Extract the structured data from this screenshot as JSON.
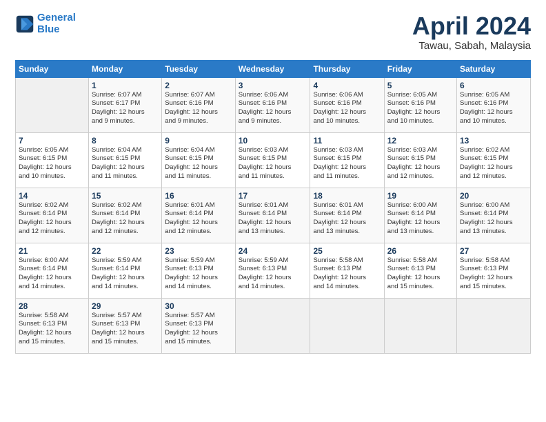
{
  "header": {
    "logo_line1": "General",
    "logo_line2": "Blue",
    "month": "April 2024",
    "location": "Tawau, Sabah, Malaysia"
  },
  "weekdays": [
    "Sunday",
    "Monday",
    "Tuesday",
    "Wednesday",
    "Thursday",
    "Friday",
    "Saturday"
  ],
  "weeks": [
    [
      {
        "day": "",
        "info": ""
      },
      {
        "day": "1",
        "info": "Sunrise: 6:07 AM\nSunset: 6:17 PM\nDaylight: 12 hours\nand 9 minutes."
      },
      {
        "day": "2",
        "info": "Sunrise: 6:07 AM\nSunset: 6:16 PM\nDaylight: 12 hours\nand 9 minutes."
      },
      {
        "day": "3",
        "info": "Sunrise: 6:06 AM\nSunset: 6:16 PM\nDaylight: 12 hours\nand 9 minutes."
      },
      {
        "day": "4",
        "info": "Sunrise: 6:06 AM\nSunset: 6:16 PM\nDaylight: 12 hours\nand 10 minutes."
      },
      {
        "day": "5",
        "info": "Sunrise: 6:05 AM\nSunset: 6:16 PM\nDaylight: 12 hours\nand 10 minutes."
      },
      {
        "day": "6",
        "info": "Sunrise: 6:05 AM\nSunset: 6:16 PM\nDaylight: 12 hours\nand 10 minutes."
      }
    ],
    [
      {
        "day": "7",
        "info": "Sunrise: 6:05 AM\nSunset: 6:15 PM\nDaylight: 12 hours\nand 10 minutes."
      },
      {
        "day": "8",
        "info": "Sunrise: 6:04 AM\nSunset: 6:15 PM\nDaylight: 12 hours\nand 11 minutes."
      },
      {
        "day": "9",
        "info": "Sunrise: 6:04 AM\nSunset: 6:15 PM\nDaylight: 12 hours\nand 11 minutes."
      },
      {
        "day": "10",
        "info": "Sunrise: 6:03 AM\nSunset: 6:15 PM\nDaylight: 12 hours\nand 11 minutes."
      },
      {
        "day": "11",
        "info": "Sunrise: 6:03 AM\nSunset: 6:15 PM\nDaylight: 12 hours\nand 11 minutes."
      },
      {
        "day": "12",
        "info": "Sunrise: 6:03 AM\nSunset: 6:15 PM\nDaylight: 12 hours\nand 12 minutes."
      },
      {
        "day": "13",
        "info": "Sunrise: 6:02 AM\nSunset: 6:15 PM\nDaylight: 12 hours\nand 12 minutes."
      }
    ],
    [
      {
        "day": "14",
        "info": "Sunrise: 6:02 AM\nSunset: 6:14 PM\nDaylight: 12 hours\nand 12 minutes."
      },
      {
        "day": "15",
        "info": "Sunrise: 6:02 AM\nSunset: 6:14 PM\nDaylight: 12 hours\nand 12 minutes."
      },
      {
        "day": "16",
        "info": "Sunrise: 6:01 AM\nSunset: 6:14 PM\nDaylight: 12 hours\nand 12 minutes."
      },
      {
        "day": "17",
        "info": "Sunrise: 6:01 AM\nSunset: 6:14 PM\nDaylight: 12 hours\nand 13 minutes."
      },
      {
        "day": "18",
        "info": "Sunrise: 6:01 AM\nSunset: 6:14 PM\nDaylight: 12 hours\nand 13 minutes."
      },
      {
        "day": "19",
        "info": "Sunrise: 6:00 AM\nSunset: 6:14 PM\nDaylight: 12 hours\nand 13 minutes."
      },
      {
        "day": "20",
        "info": "Sunrise: 6:00 AM\nSunset: 6:14 PM\nDaylight: 12 hours\nand 13 minutes."
      }
    ],
    [
      {
        "day": "21",
        "info": "Sunrise: 6:00 AM\nSunset: 6:14 PM\nDaylight: 12 hours\nand 14 minutes."
      },
      {
        "day": "22",
        "info": "Sunrise: 5:59 AM\nSunset: 6:14 PM\nDaylight: 12 hours\nand 14 minutes."
      },
      {
        "day": "23",
        "info": "Sunrise: 5:59 AM\nSunset: 6:13 PM\nDaylight: 12 hours\nand 14 minutes."
      },
      {
        "day": "24",
        "info": "Sunrise: 5:59 AM\nSunset: 6:13 PM\nDaylight: 12 hours\nand 14 minutes."
      },
      {
        "day": "25",
        "info": "Sunrise: 5:58 AM\nSunset: 6:13 PM\nDaylight: 12 hours\nand 14 minutes."
      },
      {
        "day": "26",
        "info": "Sunrise: 5:58 AM\nSunset: 6:13 PM\nDaylight: 12 hours\nand 15 minutes."
      },
      {
        "day": "27",
        "info": "Sunrise: 5:58 AM\nSunset: 6:13 PM\nDaylight: 12 hours\nand 15 minutes."
      }
    ],
    [
      {
        "day": "28",
        "info": "Sunrise: 5:58 AM\nSunset: 6:13 PM\nDaylight: 12 hours\nand 15 minutes."
      },
      {
        "day": "29",
        "info": "Sunrise: 5:57 AM\nSunset: 6:13 PM\nDaylight: 12 hours\nand 15 minutes."
      },
      {
        "day": "30",
        "info": "Sunrise: 5:57 AM\nSunset: 6:13 PM\nDaylight: 12 hours\nand 15 minutes."
      },
      {
        "day": "",
        "info": ""
      },
      {
        "day": "",
        "info": ""
      },
      {
        "day": "",
        "info": ""
      },
      {
        "day": "",
        "info": ""
      }
    ]
  ]
}
